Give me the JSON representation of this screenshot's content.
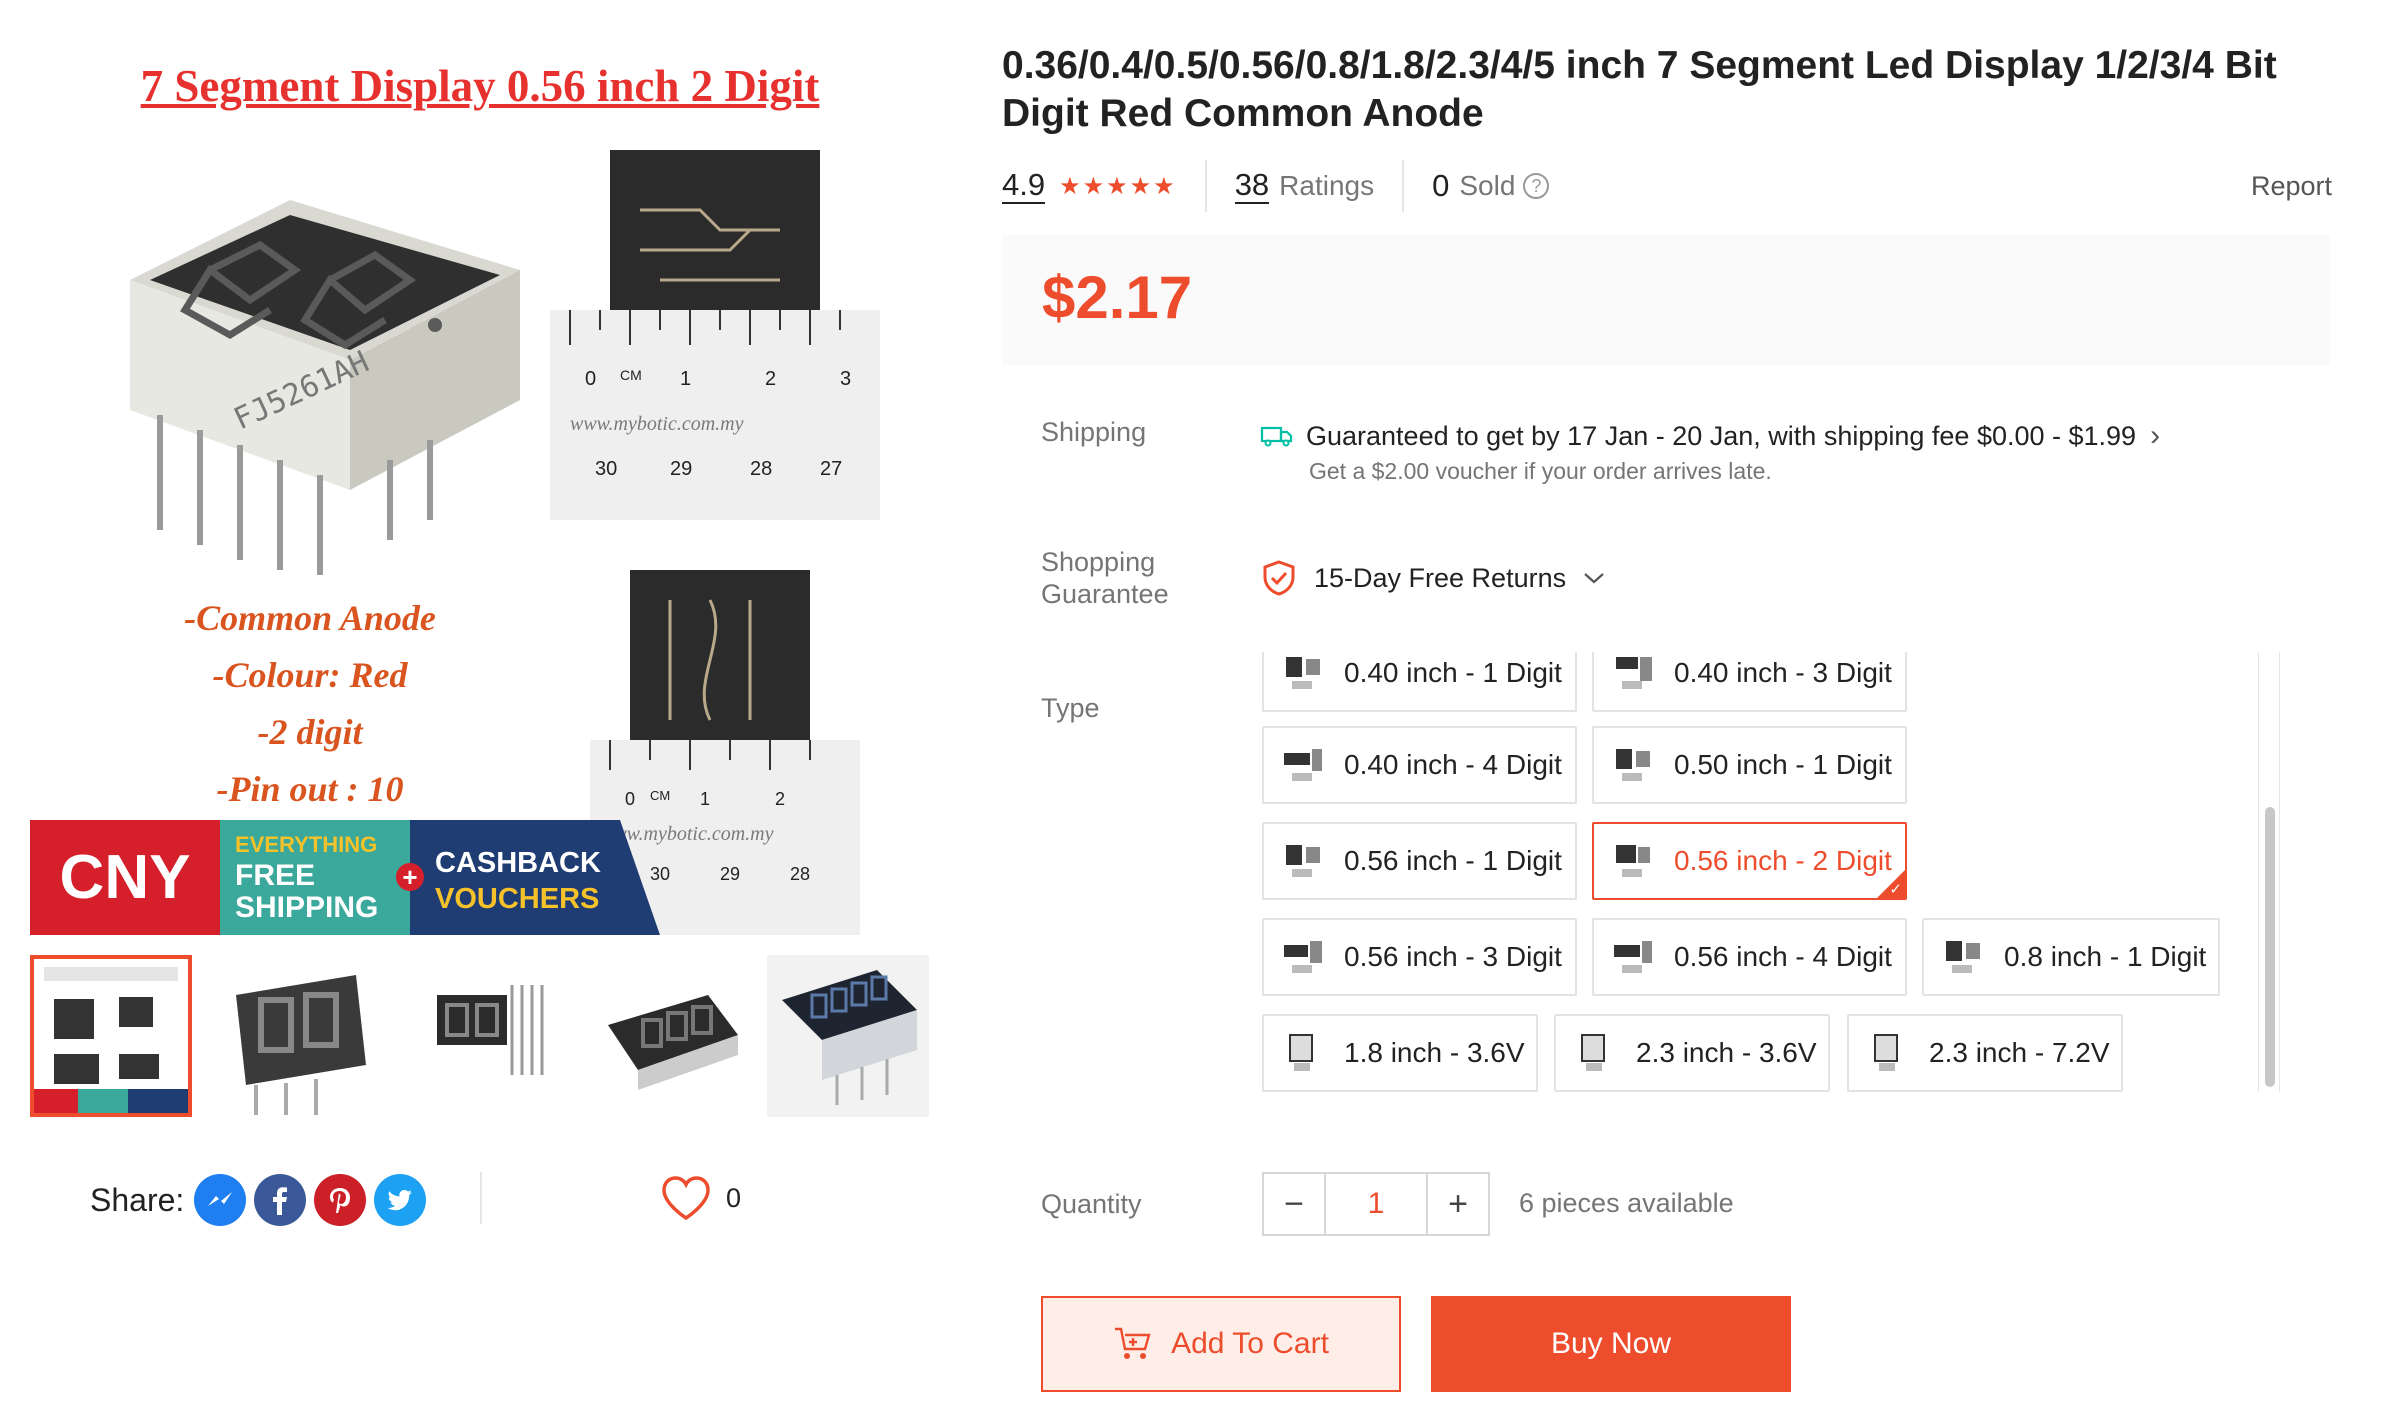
{
  "gallery": {
    "headline": "7 Segment Display 0.56 inch 2 Digit",
    "specs": [
      "-Common Anode",
      "-Colour: Red",
      "-2 digit",
      "-Pin out : 10"
    ],
    "watermark": "www.mybotic.com.my",
    "ruler_top_numbers": [
      "0",
      "CM",
      "1",
      "2",
      "3"
    ],
    "ruler_bottom_numbers": [
      "30",
      "29",
      "28",
      "27"
    ],
    "part_marking": "FJ5261AH",
    "promo": {
      "cny": "CNY",
      "free_line1": "EVERYTHING",
      "free_line2": "FREE",
      "free_line3": "SHIPPING",
      "plus": "+",
      "cash_line1": "CASHBACK",
      "cash_line2": "VOUCHERS"
    },
    "thumbnails": [
      "thumb-1",
      "thumb-2",
      "thumb-3",
      "thumb-4",
      "thumb-5"
    ],
    "active_thumb": 0
  },
  "share": {
    "label": "Share:",
    "icons": [
      "messenger-icon",
      "facebook-icon",
      "pinterest-icon",
      "twitter-icon"
    ],
    "favorite_count": "0"
  },
  "product": {
    "title": "0.36/0.4/0.5/0.56/0.8/1.8/2.3/4/5 inch 7 Segment Led Display 1/2/3/4 Bit Digit Red Common Anode",
    "rating": "4.9",
    "rating_stars": 5,
    "ratings_count": "38",
    "ratings_label": "Ratings",
    "sold_count": "0",
    "sold_label": "Sold",
    "report_label": "Report",
    "price": "$2.17"
  },
  "shipping": {
    "label": "Shipping",
    "main": "Guaranteed to get by 17 Jan - 20 Jan, with shipping fee $0.00 - $1.99",
    "sub": "Get a $2.00 voucher if your order arrives late."
  },
  "guarantee": {
    "label_line1": "Shopping",
    "label_line2": "Guarantee",
    "text": "15-Day Free Returns"
  },
  "type": {
    "label": "Type",
    "options": [
      "0.40 inch - 1 Digit",
      "0.40 inch - 3 Digit",
      "0.40 inch - 4 Digit",
      "0.50 inch - 1 Digit",
      "0.56 inch - 1 Digit",
      "0.56 inch - 2 Digit",
      "0.56 inch - 3 Digit",
      "0.56 inch - 4 Digit",
      "0.8 inch - 1 Digit",
      "1.8 inch - 3.6V",
      "2.3 inch - 3.6V",
      "2.3 inch - 7.2V"
    ],
    "selected": "0.56 inch - 2 Digit"
  },
  "quantity": {
    "label": "Quantity",
    "minus": "−",
    "value": "1",
    "plus": "+",
    "available": "6 pieces available"
  },
  "actions": {
    "add_to_cart": "Add To Cart",
    "buy_now": "Buy Now"
  },
  "colors": {
    "accent": "#ee4d2d",
    "cny_red": "#d5202b",
    "promo_teal": "#3aa89a",
    "promo_navy": "#1f3c73",
    "promo_yellow": "#f6c229"
  }
}
